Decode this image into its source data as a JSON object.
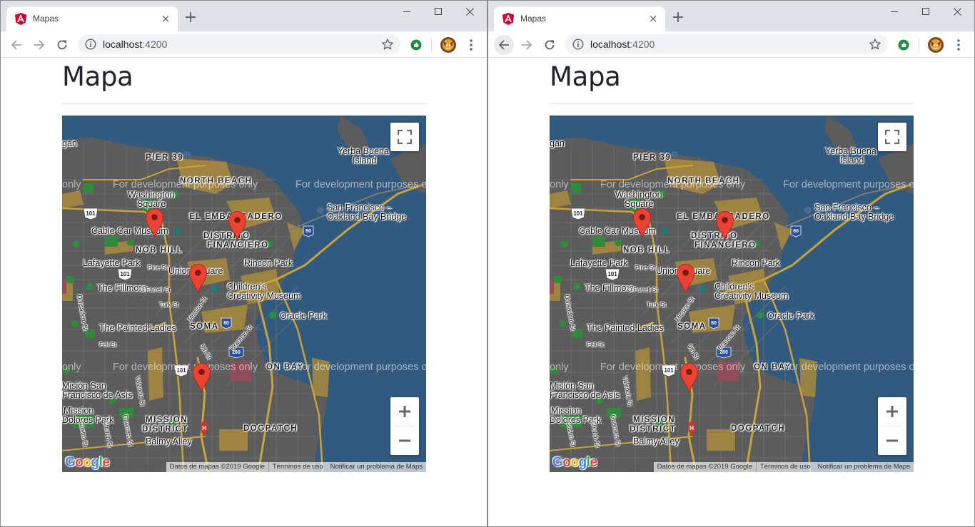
{
  "windows": [
    {
      "tab": {
        "title": "Mapas",
        "close": "×"
      },
      "new_tab": "+",
      "url": {
        "host": "localhost",
        "port": ":4200"
      },
      "back_enabled": false,
      "page": {
        "title": "Mapa"
      },
      "map": {
        "dev_watermark": "For development purposes only",
        "dev_watermark_clipped": "only",
        "labels": {
          "pier39": "PIER 39",
          "yerba1": "Yerba Buena",
          "yerba2": "Island",
          "north_beach": "NORTH BEACH",
          "washington1": "Washington",
          "washington2": "Square",
          "sf_bridge1": "San Francisco –",
          "sf_bridge2": "Oakland Bay Bridge",
          "embarcadero": "EL EMBARCADERO",
          "cable_car": "Cable Car Museum",
          "distrito": "DISTRITO",
          "financiero": "FINANCIERO",
          "nob_hill": "NOB HILL",
          "lafayette": "Lafayette Park",
          "rincon": "Rincon Park",
          "union_square": "Union Square",
          "fillmore": "The Fillmore",
          "childrens1": "Children's",
          "childrens2": "Creativity Museum",
          "oracle": "Oracle Park",
          "painted_ladies": "The Painted Ladies",
          "soma": "SOMA",
          "mission_dolores1": "Misión San",
          "mission_dolores2": "Francisco de Asís",
          "mission_dolores_park1": "Mission",
          "mission_dolores_park2": "Dolores Park",
          "mission_district1": "MISSION",
          "mission_district2": "DISTRICT",
          "balmy": "Balmy Alley",
          "dogpatch": "DOGPATCH",
          "gan": "gan",
          "ry": "ry",
          "hwy101": "101",
          "hwy80": "80",
          "hwy280": "280",
          "pine": "Pine St",
          "ofarrell": "O'Farrell St",
          "turk": "Turk St",
          "mission_st": "Mission St",
          "brannan": "Brannan St",
          "ninth": "9th St",
          "valencia": "Valencia St",
          "guerrero": "Guerrero St",
          "fell": "Fell St",
          "church": "Church St",
          "castro": "Castro St",
          "divisadero": "Divisadero St",
          "on_bay": "ON BAY"
        },
        "attribution": {
          "data": "Datos de mapas ©2019 Google",
          "terms": "Términos de uso",
          "report": "Notificar un problema de Maps"
        },
        "logo": "Google"
      }
    },
    {
      "tab": {
        "title": "Mapas",
        "close": "×"
      },
      "new_tab": "+",
      "url": {
        "host": "localhost",
        "port": ":4200"
      },
      "back_enabled": true,
      "page": {
        "title": "Mapa"
      },
      "map": {
        "dev_watermark": "For development purposes only",
        "dev_watermark_clipped": "only",
        "labels": {
          "pier39": "PIER 39",
          "yerba1": "Yerba Buena",
          "yerba2": "Island",
          "north_beach": "NORTH BEACH",
          "washington1": "Washington",
          "washington2": "Square",
          "sf_bridge1": "San Francisco –",
          "sf_bridge2": "Oakland Bay Bridge",
          "embarcadero": "EL EMBARCADERO",
          "cable_car": "Cable Car Museum",
          "distrito": "DISTRITO",
          "financiero": "FINANCIERO",
          "nob_hill": "NOB HILL",
          "lafayette": "Lafayette Park",
          "rincon": "Rincon Park",
          "union_square": "Union Square",
          "fillmore": "The Fillmore",
          "childrens1": "Children's",
          "childrens2": "Creativity Museum",
          "oracle": "Oracle Park",
          "painted_ladies": "The Painted Ladies",
          "soma": "SOMA",
          "mission_dolores1": "Misión San",
          "mission_dolores2": "Francisco de Asís",
          "mission_dolores_park1": "Mission",
          "mission_dolores_park2": "Dolores Park",
          "mission_district1": "MISSION",
          "mission_district2": "DISTRICT",
          "balmy": "Balmy Alley",
          "dogpatch": "DOGPATCH",
          "gan": "gan",
          "ry": "ry",
          "hwy101": "101",
          "hwy80": "80",
          "hwy280": "280",
          "pine": "Pine St",
          "ofarrell": "O'Farrell St",
          "turk": "Turk St",
          "mission_st": "Mission St",
          "brannan": "Brannan St",
          "ninth": "9th St",
          "valencia": "Valencia St",
          "guerrero": "Guerrero St",
          "fell": "Fell St",
          "church": "Church St",
          "castro": "Castro St",
          "divisadero": "Divisadero St",
          "on_bay": "ON BAY"
        },
        "attribution": {
          "data": "Datos de mapas ©2019 Google",
          "terms": "Términos de uso",
          "report": "Notificar un problema de Maps"
        },
        "logo": "Google"
      }
    }
  ],
  "colors": {
    "water": "#32597e",
    "land": "#5d5d5d",
    "highway": "#c9a33a",
    "park": "#2f8a3c",
    "marker": "#ea4335",
    "marker_dot": "#7a1a12",
    "chrome_bg": "#dee1e6",
    "angular_red": "#dd0031",
    "ext_green": "#1e8e3e"
  },
  "icons": [
    "angular-favicon",
    "close-icon",
    "plus-icon",
    "minimize-icon",
    "maximize-icon",
    "window-close-icon",
    "back-arrow-icon",
    "forward-arrow-icon",
    "reload-icon",
    "info-icon",
    "star-icon",
    "extension-icon",
    "avatar",
    "menu-dots-icon",
    "fullscreen-icon",
    "zoom-in-icon",
    "zoom-out-icon",
    "map-marker-icon",
    "google-logo"
  ]
}
